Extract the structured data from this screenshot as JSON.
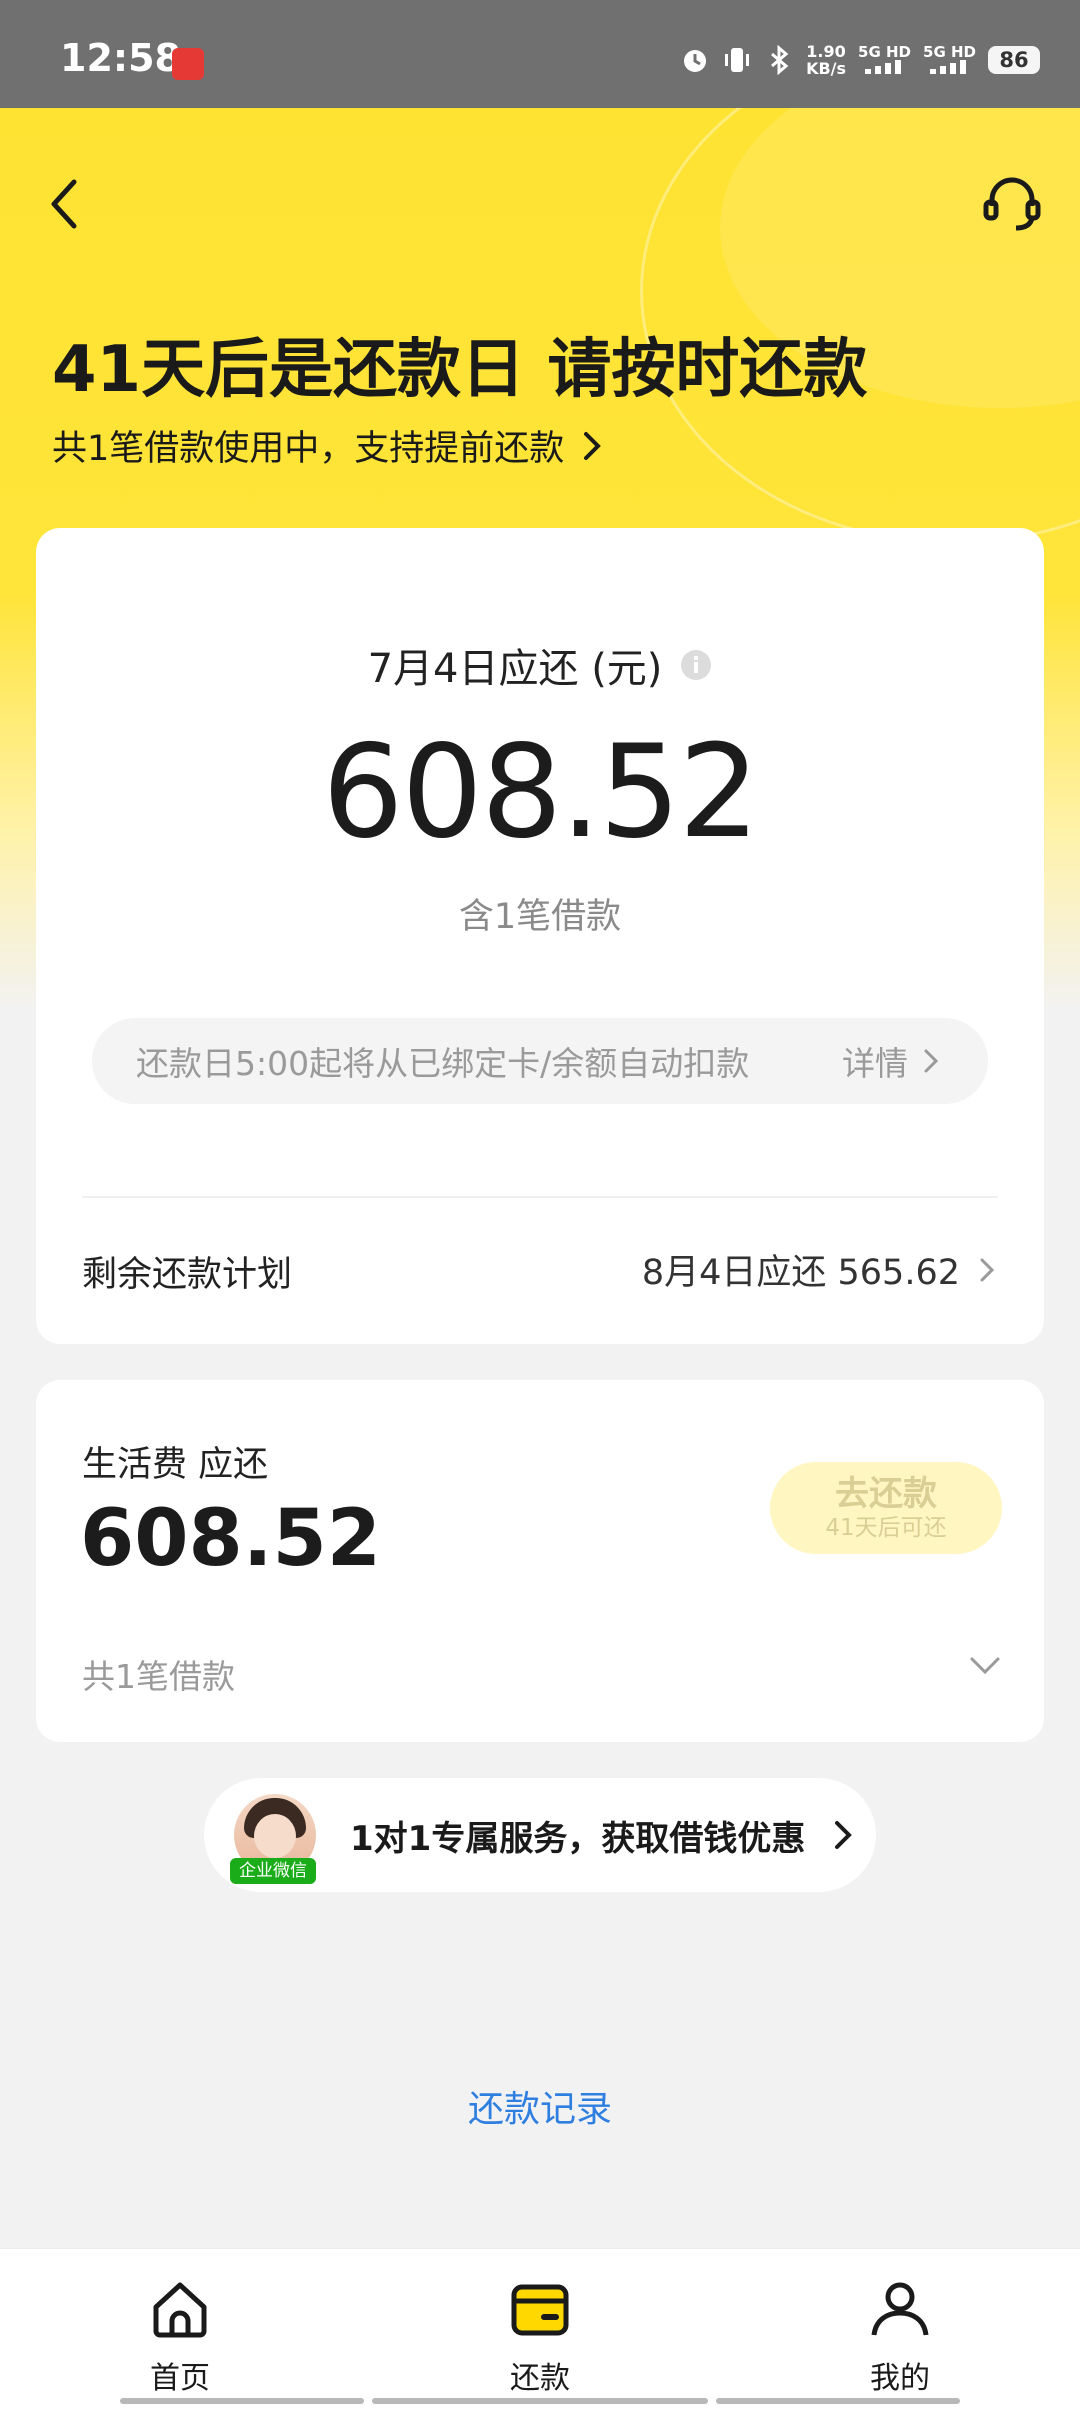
{
  "status_bar": {
    "time": "12:58",
    "speed_top": "1.90",
    "speed_bottom": "KB/s",
    "signal_1": "5G HD",
    "signal_2": "5G HD",
    "battery": "86"
  },
  "header": {
    "title": "41天后是还款日 请按时还款",
    "subtitle": "共1笔借款使用中，支持提前还款"
  },
  "summary_card": {
    "due_label": "7月4日应还 (元)",
    "amount": "608.52",
    "loan_count": "含1笔借款",
    "autopay_text": "还款日5:00起将从已绑定卡/余额自动扣款",
    "autopay_detail": "详情",
    "plan_label": "剩余还款计划",
    "plan_value": "8月4日应还 565.62"
  },
  "loan_card": {
    "name": "生活费 应还",
    "amount": "608.52",
    "button_label": "去还款",
    "button_sub": "41天后可还",
    "footer": "共1笔借款"
  },
  "promo": {
    "badge": "企业微信",
    "text": "1对1专属服务，获取借钱优惠"
  },
  "records_link": "还款记录",
  "nav": {
    "home": "首页",
    "repay": "还款",
    "me": "我的"
  },
  "colors": {
    "brand_yellow": "#ffe333",
    "link_blue": "#2f7fe0",
    "wechat_green": "#1aad19"
  }
}
